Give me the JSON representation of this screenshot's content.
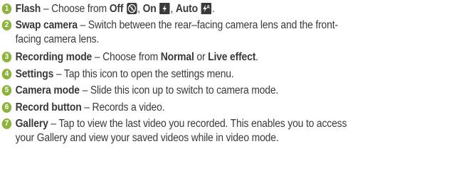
{
  "items": [
    {
      "num": "1",
      "term": "Flash",
      "dash": " – ",
      "text": "Choose from ",
      "opt1": "Off",
      "sep1": ", ",
      "opt2": "On",
      "sep2": ", ",
      "opt3": "Auto",
      "end": "."
    },
    {
      "num": "2",
      "term": "Swap camera",
      "dash": " – ",
      "text": "Switch between the rear–facing camera lens and the front-",
      "text2": "facing camera lens."
    },
    {
      "num": "3",
      "term": "Recording mode",
      "dash": " – ",
      "text": "Choose from ",
      "opt1": "Normal",
      "mid": " or ",
      "opt2": "Live effect",
      "end": "."
    },
    {
      "num": "4",
      "term": "Settings",
      "dash": " – ",
      "text": "Tap this icon to open the settings menu."
    },
    {
      "num": "5",
      "term": "Camera mode",
      "dash": " – ",
      "text": "Slide this icon up to switch to camera mode."
    },
    {
      "num": "6",
      "term": "Record button",
      "dash": " – ",
      "text": "Records a video."
    },
    {
      "num": "7",
      "term": "Gallery",
      "dash": " – ",
      "text": "Tap to view the last video you recorded. This enables you to access",
      "text2": "your Gallery and view your saved videos while in video mode."
    }
  ],
  "icons": {
    "flash_off": "flash-off-icon",
    "flash_on": "flash-on-icon",
    "flash_auto": "flash-auto-icon"
  },
  "colors": {
    "bullet": "#8db33d",
    "text": "#3a3a3a"
  }
}
